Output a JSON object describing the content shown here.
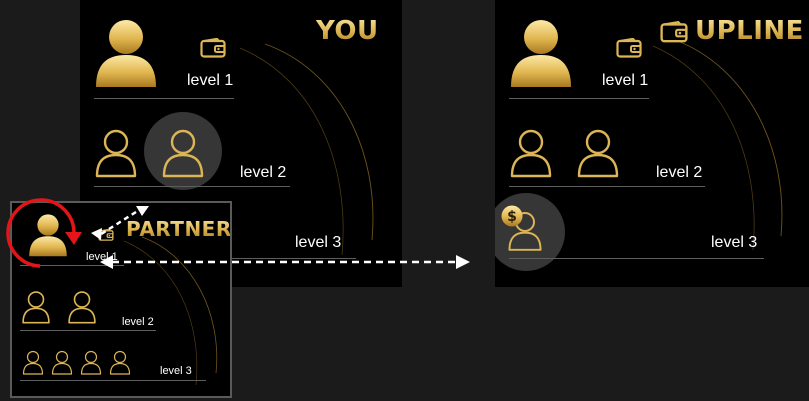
{
  "colors": {
    "gold": "#e2be62",
    "gold_dark": "#a97a20",
    "panel": "#000000",
    "background": "#1b1b1b",
    "arrow_red": "#e3151a",
    "arrow_white": "#ffffff"
  },
  "you": {
    "title": "YOU",
    "level1": "level 1",
    "level2": "level 2",
    "level3": "level 3"
  },
  "upline": {
    "title": "UPLINE",
    "level1": "level 1",
    "level2": "level 2",
    "level3": "level 3"
  },
  "partner": {
    "title": "PARTNER",
    "level1": "level 1",
    "level2": "level 2",
    "level3": "level 3"
  },
  "icons": [
    "user-icon",
    "wallet-icon",
    "user-outline-icon",
    "dollar-coin-icon",
    "arrow-icon"
  ]
}
